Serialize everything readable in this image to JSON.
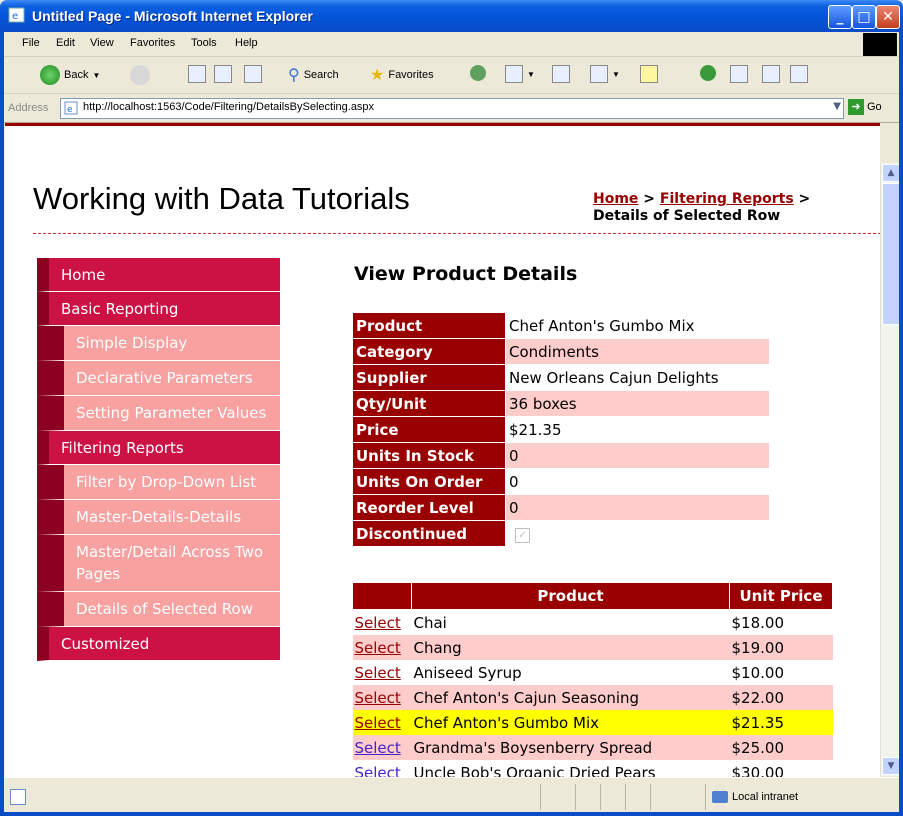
{
  "window": {
    "title": "Untitled Page - Microsoft Internet Explorer",
    "buttons": {
      "minimize": "_",
      "maximize": "□",
      "close": "✕"
    }
  },
  "menu": [
    "File",
    "Edit",
    "View",
    "Favorites",
    "Tools",
    "Help"
  ],
  "toolbar": {
    "back": "Back",
    "search": "Search",
    "favorites": "Favorites"
  },
  "address": {
    "label": "Address",
    "url": "http://localhost:1563/Code/Filtering/DetailsBySelecting.aspx",
    "go": "Go"
  },
  "page": {
    "title": "Working with Data Tutorials",
    "breadcrumb": {
      "home": "Home",
      "sep1": " > ",
      "filtering": "Filtering Reports",
      "sep2": " >",
      "current": "Details of Selected Row"
    },
    "section_title": "View Product Details"
  },
  "sidebar": {
    "items": [
      {
        "label": "Home",
        "level": "top"
      },
      {
        "label": "Basic Reporting",
        "level": "top"
      },
      {
        "label": "Simple Display",
        "level": "sub"
      },
      {
        "label": "Declarative Parameters",
        "level": "sub"
      },
      {
        "label": "Setting Parameter Values",
        "level": "sub"
      },
      {
        "label": "Filtering Reports",
        "level": "top"
      },
      {
        "label": "Filter by Drop-Down List",
        "level": "sub"
      },
      {
        "label": "Master-Details-Details",
        "level": "sub"
      },
      {
        "label": "Master/Detail Across Two Pages",
        "level": "sub"
      },
      {
        "label": "Details of Selected Row",
        "level": "sub"
      },
      {
        "label": "Customized",
        "level": "top"
      }
    ]
  },
  "details": [
    {
      "field": "Product",
      "value": "Chef Anton's Gumbo Mix"
    },
    {
      "field": "Category",
      "value": "Condiments"
    },
    {
      "field": "Supplier",
      "value": "New Orleans Cajun Delights"
    },
    {
      "field": "Qty/Unit",
      "value": "36 boxes"
    },
    {
      "field": "Price",
      "value": "$21.35"
    },
    {
      "field": "Units In Stock",
      "value": "0"
    },
    {
      "field": "Units On Order",
      "value": "0"
    },
    {
      "field": "Reorder Level",
      "value": "0"
    },
    {
      "field": "Discontinued",
      "value": ""
    }
  ],
  "discontinued_checked": true,
  "grid": {
    "headers": [
      "",
      "Product",
      "Unit Price"
    ],
    "select_label": "Select",
    "rows": [
      {
        "product": "Chai",
        "price": "$18.00"
      },
      {
        "product": "Chang",
        "price": "$19.00"
      },
      {
        "product": "Aniseed Syrup",
        "price": "$10.00"
      },
      {
        "product": "Chef Anton's Cajun Seasoning",
        "price": "$22.00"
      },
      {
        "product": "Chef Anton's Gumbo Mix",
        "price": "$21.35"
      },
      {
        "product": "Grandma's Boysenberry Spread",
        "price": "$25.00"
      },
      {
        "product": "Uncle Bob's Organic Dried Pears",
        "price": "$30.00"
      }
    ],
    "selected_index": 4
  },
  "status": {
    "zone": "Local intranet"
  },
  "colors": {
    "accent": "#990000",
    "menu_top": "#cc1144",
    "menu_sub": "#f7a1a1",
    "row_alt": "#ffcccc",
    "row_selected": "#ffff00"
  }
}
